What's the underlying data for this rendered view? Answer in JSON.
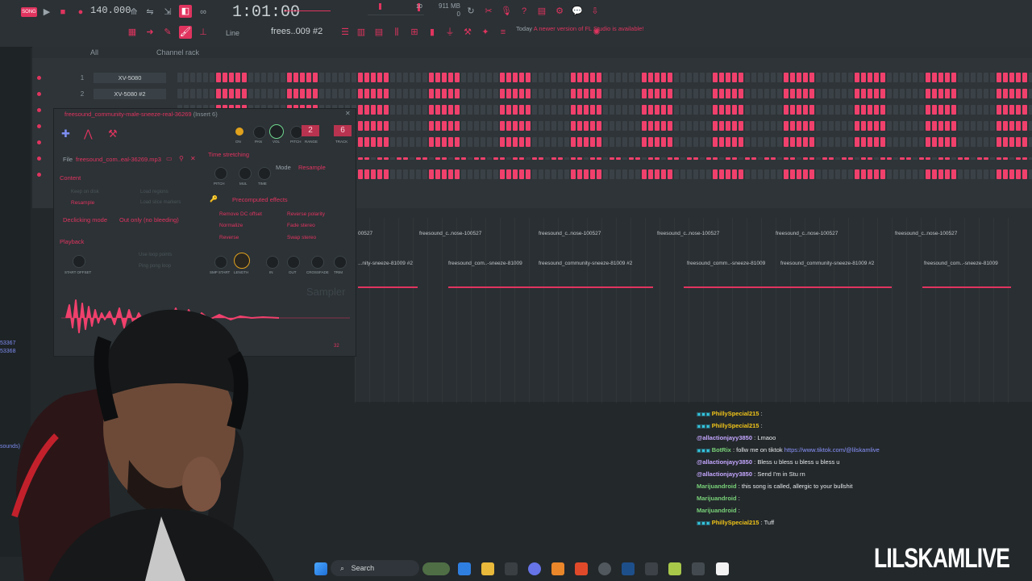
{
  "toolbar": {
    "tempo": "140.000",
    "time": "1:01:00",
    "cpu": "10",
    "memory": "911 MB",
    "memory_sub": "0",
    "pattern": "frees..009 #2",
    "snap": "Line",
    "news_today": "Today",
    "news_text": "A newer version of FL Studio is available!",
    "song_label": "SONG"
  },
  "channel_rack": {
    "title": "Channel rack",
    "filter": "All",
    "channels": [
      {
        "num": "1",
        "name": "XV-5080"
      },
      {
        "num": "2",
        "name": "XV-5080 #2"
      }
    ]
  },
  "sampler": {
    "title": "freesound_community-male-sneeze-real-36269",
    "insert": "(Insert 6)",
    "file_label": "File",
    "file_name": "freesound_com..eal-36269.mp3",
    "time_stretching": "Time stretching",
    "mode_label": "Mode",
    "mode_value": "Resample",
    "content": "Content",
    "keep_on_disk": "Keep on disk",
    "load_regions": "Load regions",
    "resample": "Resample",
    "load_slice_markers": "Load slice markers",
    "declicking_mode": "Declicking mode",
    "declicking_value": "Out only (no bleeding)",
    "precomputed": "Precomputed effects",
    "remove_dc": "Remove DC offset",
    "reverse_polarity": "Reverse polarity",
    "normalize": "Normalize",
    "fade_stereo": "Fade stereo",
    "reverse": "Reverse",
    "swap_stereo": "Swap stereo",
    "playback": "Playback",
    "use_loop_points": "Use loop points",
    "ping_pong_loop": "Ping pong loop",
    "start_offset": "START OFFSET",
    "track_num": "6",
    "pitch_range": "2",
    "sampler_brand": "Sampler",
    "bits": "32",
    "knob_labels": {
      "on": "ON",
      "pan": "PAN",
      "vol": "VOL",
      "pitch": "PITCH",
      "range": "RANGE",
      "track": "TRACK",
      "pitch2": "PITCH",
      "mul": "MUL",
      "time": "TIME",
      "smp_start": "SMP START",
      "length": "LENGTH",
      "in": "IN",
      "out": "OUT",
      "crossfade": "CROSSFADE",
      "trim": "TRIM"
    }
  },
  "playlist": {
    "clips_top": [
      "00527",
      "freesound_c..nose-100527",
      "freesound_c..nose-100527",
      "freesound_c..nose-100527",
      "freesound_c..nose-100527",
      "freesound_c..nose-100527"
    ],
    "clips_bottom": [
      "...nity-sneeze-81009 #2",
      "freesound_com..-sneeze-81009",
      "freesound_community-sneeze-81009 #2",
      "freesound_comm..-sneeze-81009",
      "freesound_community-sneeze-81009 #2",
      "freesound_com..-sneeze-81009"
    ]
  },
  "chat": [
    {
      "user": "PhillySpecial215",
      "sep": ":",
      "msg": "",
      "color": "y",
      "badges": true
    },
    {
      "user": "PhillySpecial215",
      "sep": ":",
      "msg": "",
      "color": "y",
      "badges": true
    },
    {
      "user": "@allactionjayy3850",
      "sep": ":",
      "msg": "Lmaoo",
      "color": "p",
      "badges": false
    },
    {
      "user": "BotRix",
      "sep": ":",
      "msg": "follw me on tiktok",
      "link": "https://www.tiktok.com/@lilskamlive",
      "color": "g",
      "badges": true
    },
    {
      "user": "@allactionjayy3850",
      "sep": ":",
      "msg": "Bless u bless u bless u bless u",
      "color": "p",
      "badges": false
    },
    {
      "user": "@allactionjayy3850",
      "sep": ":",
      "msg": "Send I'm in Stu rn",
      "color": "p",
      "badges": false
    },
    {
      "user": "Marijuandroid",
      "sep": ":",
      "msg": "this song is called, allergic to your bullshit",
      "color": "g",
      "badges": false
    },
    {
      "user": "Marijuandroid",
      "sep": ":",
      "msg": "",
      "color": "g",
      "badges": false
    },
    {
      "user": "Marijuandroid",
      "sep": ":",
      "msg": "",
      "color": "g",
      "badges": false
    },
    {
      "user": "PhillySpecial215",
      "sep": ":",
      "msg": "Tuff",
      "color": "y",
      "badges": true
    }
  ],
  "taskbar": {
    "search": "Search"
  },
  "brand": "LILSKAMLIVE",
  "left_panel": {
    "num1": "53367",
    "num2": "53368",
    "sounds": "sounds)"
  },
  "colors": {
    "accent": "#e0345f",
    "bg": "#23282b",
    "panel": "#2c3236"
  }
}
